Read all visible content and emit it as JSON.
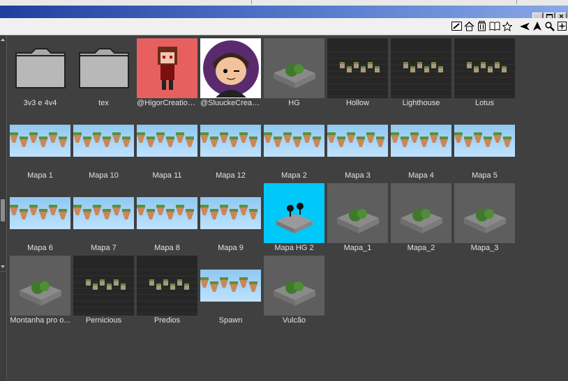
{
  "toolbar": {
    "icons": [
      "edit-icon",
      "home-icon",
      "trash-icon",
      "book-icon",
      "star-icon",
      "back-icon",
      "up-icon",
      "search-icon",
      "add-icon"
    ]
  },
  "items": [
    {
      "label": "3v3  e 4v4",
      "kind": "folder"
    },
    {
      "label": "tex",
      "kind": "folder"
    },
    {
      "label": "@HigorCreations...",
      "kind": "avatar-red"
    },
    {
      "label": "@SluuckeCreati...",
      "kind": "avatar-purple"
    },
    {
      "label": "HG",
      "kind": "grey"
    },
    {
      "label": "Hollow",
      "kind": "dark"
    },
    {
      "label": "Lighthouse",
      "kind": "dark"
    },
    {
      "label": "Lotus",
      "kind": "dark"
    },
    {
      "label": "Mapa 1",
      "kind": "sky"
    },
    {
      "label": "Mapa 10",
      "kind": "sky"
    },
    {
      "label": "Mapa 11",
      "kind": "sky"
    },
    {
      "label": "Mapa 12",
      "kind": "sky"
    },
    {
      "label": "Mapa 2",
      "kind": "sky"
    },
    {
      "label": "Mapa 3",
      "kind": "sky"
    },
    {
      "label": "Mapa 4",
      "kind": "sky"
    },
    {
      "label": "Mapa 5",
      "kind": "sky"
    },
    {
      "label": "Mapa 6",
      "kind": "sky"
    },
    {
      "label": "Mapa 7",
      "kind": "sky"
    },
    {
      "label": "Mapa 8",
      "kind": "sky"
    },
    {
      "label": "Mapa 9",
      "kind": "sky"
    },
    {
      "label": "Mapa HG 2",
      "kind": "cyan"
    },
    {
      "label": "Mapa_1",
      "kind": "grey"
    },
    {
      "label": "Mapa_2",
      "kind": "grey"
    },
    {
      "label": "Mapa_3",
      "kind": "grey"
    },
    {
      "label": "Montanha pro o...",
      "kind": "grey"
    },
    {
      "label": "Pernicious",
      "kind": "dark"
    },
    {
      "label": "Predios",
      "kind": "dark"
    },
    {
      "label": "Spawn",
      "kind": "sky"
    },
    {
      "label": "Vulcão",
      "kind": "grey"
    }
  ]
}
